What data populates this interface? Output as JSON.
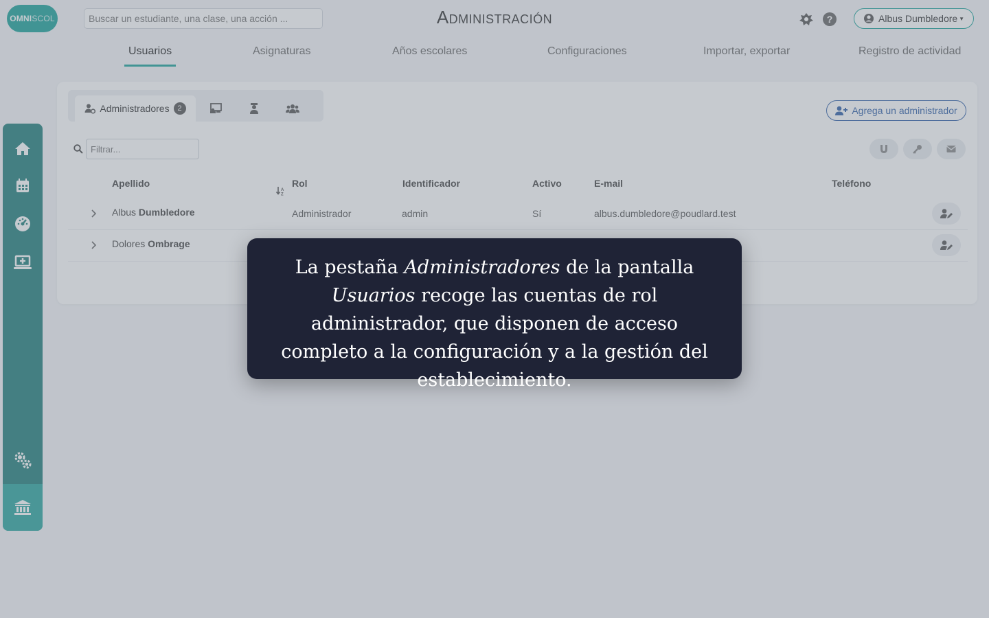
{
  "header": {
    "logo_main": "OMNI",
    "logo_thin": "SCOL",
    "search_placeholder": "Buscar un estudiante, una clase, una acción ...",
    "title": "Administración",
    "user": "Albus Dumbledore"
  },
  "tabs": [
    {
      "label": "Usuarios",
      "active": true
    },
    {
      "label": "Asignaturas"
    },
    {
      "label": "Años escolares"
    },
    {
      "label": "Configuraciones"
    },
    {
      "label": "Importar, exportar"
    },
    {
      "label": "Registro de actividad"
    }
  ],
  "sidebar": {
    "items": [
      "home-icon",
      "calendar-icon",
      "dashboard-icon",
      "screen-add-icon",
      "gears-icon",
      "institution-icon"
    ]
  },
  "card": {
    "subtab_active": "Administradores",
    "subtab_count": "2",
    "add_button": "Agrega un administrador",
    "filter_placeholder": "Filtrar...",
    "columns": {
      "apellido": "Apellido",
      "rol": "Rol",
      "identificador": "Identificador",
      "activo": "Activo",
      "email": "E-mail",
      "telefono": "Teléfono"
    },
    "rows": [
      {
        "first": "Albus",
        "last": "Dumbledore",
        "rol": "Administrador",
        "id": "admin",
        "activo": "Sí",
        "email": "albus.dumbledore@poudlard.test",
        "telefono": ""
      },
      {
        "first": "Dolores",
        "last": "Ombrage",
        "rol": "",
        "id": "",
        "activo": "",
        "email": "",
        "telefono": ""
      }
    ]
  },
  "overlay": {
    "p1": "La pestaña ",
    "em1": "Administradores",
    "p2": " de la pantalla ",
    "em2": "Usuarios",
    "p3": " recoge las cuentas de rol administrador, que disponen de acceso completo a la configuración y a la gestión del establecimiento."
  },
  "colors": {
    "accent": "#1aa39a",
    "sidebar": "#1f7f7a",
    "link_blue": "#2f5fa8",
    "caption_bg": "#1f2336"
  }
}
